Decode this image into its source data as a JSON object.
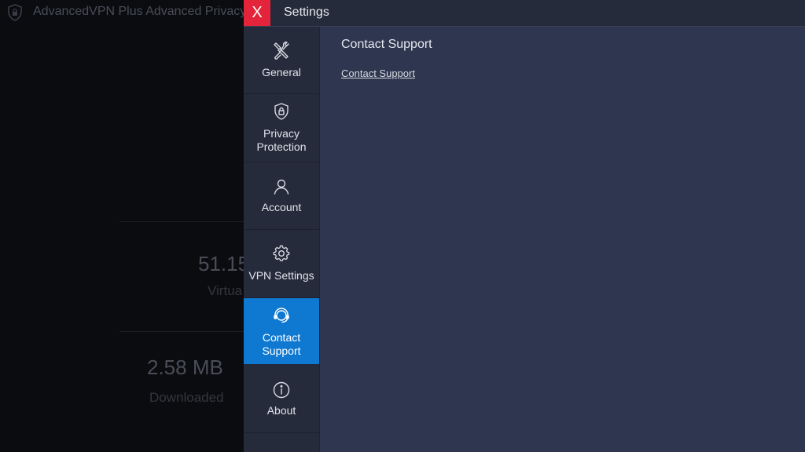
{
  "background_window": {
    "title": "AdvancedVPN Plus Advanced Privacy C",
    "stats": [
      {
        "value": "51.15",
        "label": "Virtua"
      },
      {
        "value": "2.58 MB",
        "label": "Downloaded"
      }
    ]
  },
  "settings": {
    "close_label": "X",
    "title": "Settings",
    "sidebar": {
      "items": [
        {
          "label": "General",
          "icon": "tools-icon"
        },
        {
          "label": "Privacy\nProtection",
          "icon": "shield-lock-icon"
        },
        {
          "label": "Account",
          "icon": "user-icon"
        },
        {
          "label": "VPN Settings",
          "icon": "gear-icon"
        },
        {
          "label": "Contact\nSupport",
          "icon": "headset-icon",
          "active": true
        },
        {
          "label": "About",
          "icon": "info-icon"
        }
      ]
    },
    "content": {
      "heading": "Contact Support",
      "link": "Contact Support"
    }
  },
  "colors": {
    "close_button": "#e4243a",
    "active_item": "#0f79d1",
    "panel_bg": "#2e3650",
    "sidebar_bg": "#262b3b"
  }
}
